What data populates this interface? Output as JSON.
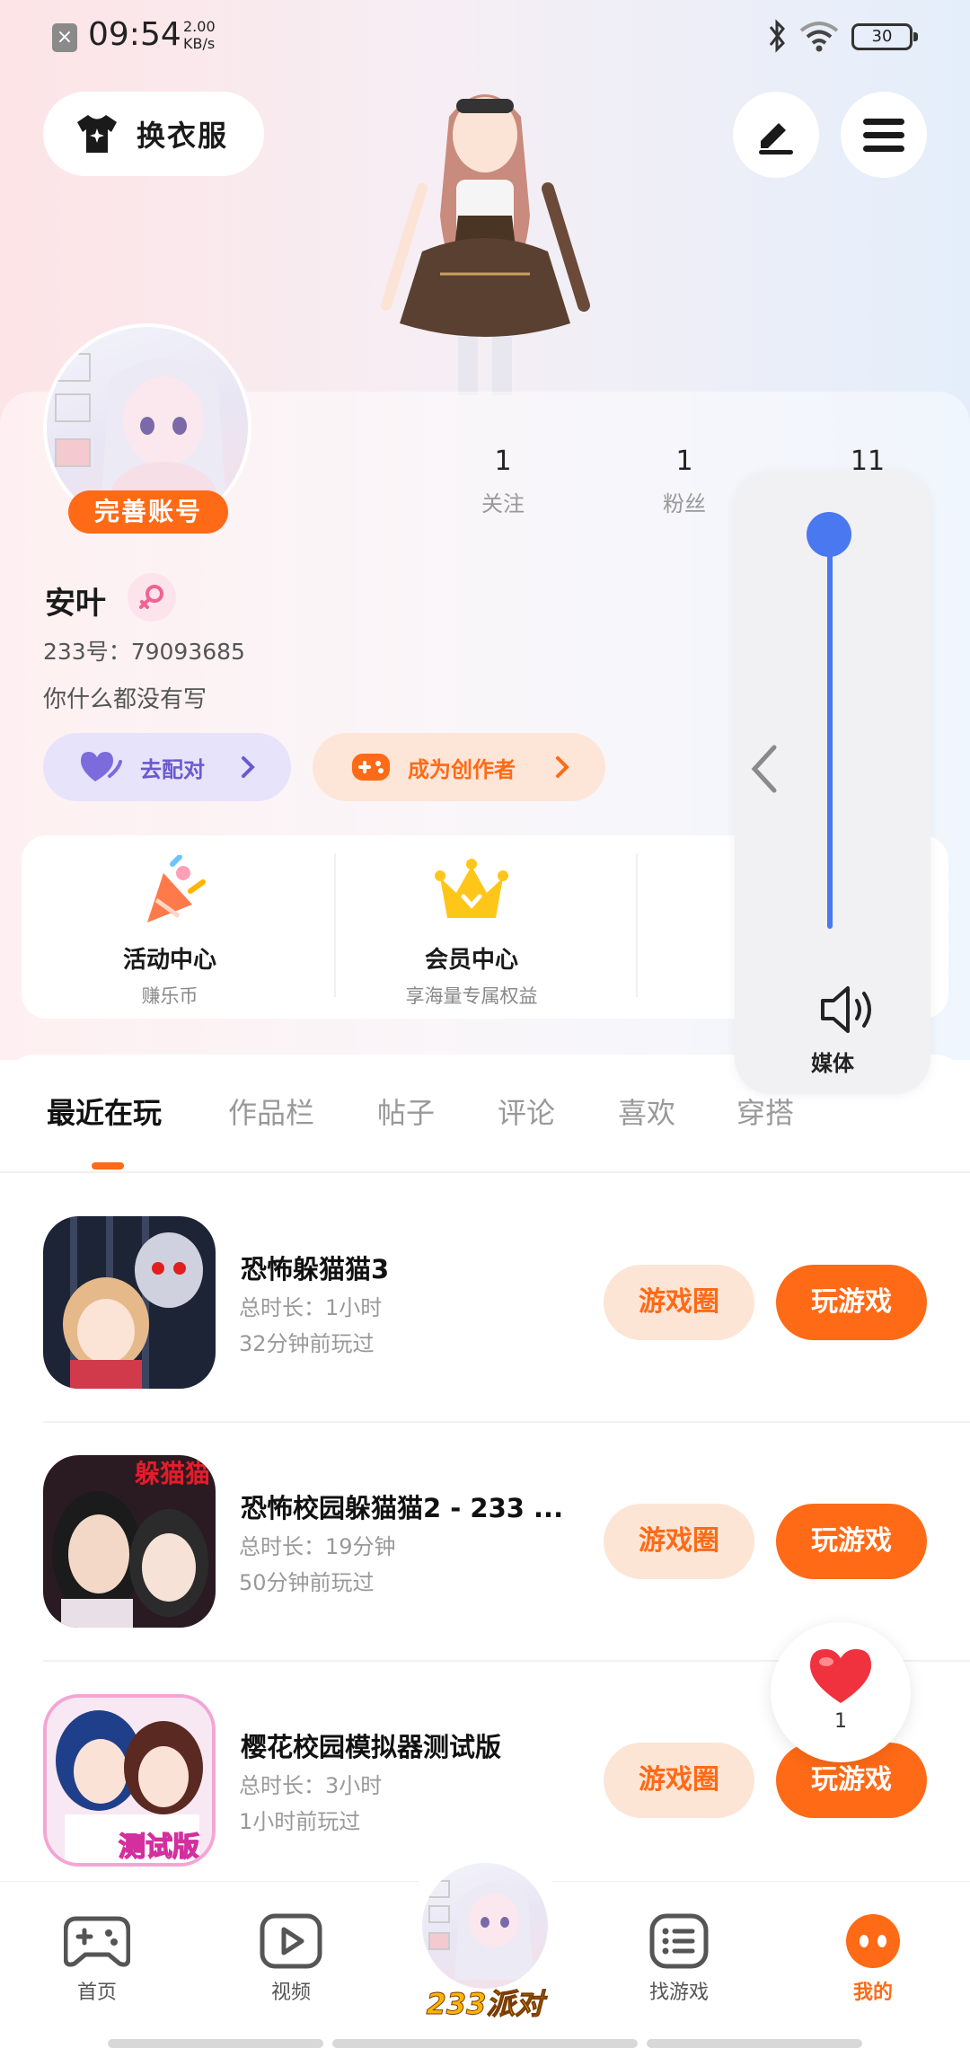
{
  "status_bar": {
    "time": "09:54",
    "speed_value": "2.00",
    "speed_unit": "KB/s",
    "battery": "30"
  },
  "header": {
    "dress_button": "换衣服"
  },
  "profile": {
    "complete_account": "完善账号",
    "stats": [
      {
        "value": "1",
        "label": "关注"
      },
      {
        "value": "1",
        "label": "粉丝"
      },
      {
        "value": "11",
        "label": ""
      }
    ],
    "name": "安叶",
    "uid": "233号：79093685",
    "bio": "你什么都没有写",
    "pair_button": "去配对",
    "creator_button": "成为创作者"
  },
  "features": [
    {
      "title": "活动中心",
      "subtitle": "赚乐币"
    },
    {
      "title": "会员中心",
      "subtitle": "享海量专属权益"
    }
  ],
  "tabs": [
    "最近在玩",
    "作品栏",
    "帖子",
    "评论",
    "喜欢",
    "穿搭"
  ],
  "games": [
    {
      "title": "恐怖躲猫猫3",
      "duration": "总时长：1小时",
      "last_played": "32分钟前玩过",
      "circle_btn": "游戏圈",
      "play_btn": "玩游戏",
      "icon_text": ""
    },
    {
      "title": "恐怖校园躲猫猫2 - 233 ...",
      "duration": "总时长：19分钟",
      "last_played": "50分钟前玩过",
      "circle_btn": "游戏圈",
      "play_btn": "玩游戏",
      "icon_text": "躲猫猫"
    },
    {
      "title": "樱花校园模拟器测试版",
      "duration": "总时长：3小时",
      "last_played": "1小时前玩过",
      "circle_btn": "游戏圈",
      "play_btn": "玩游戏",
      "icon_text": "测试版"
    }
  ],
  "volume": {
    "label": "媒体",
    "level": 1.0
  },
  "like_float": {
    "count": "1"
  },
  "bottom_nav": {
    "items": [
      {
        "label": "首页"
      },
      {
        "label": "视频"
      },
      {
        "label": "233派对"
      },
      {
        "label": "找游戏"
      },
      {
        "label": "我的"
      }
    ]
  },
  "colors": {
    "accent": "#ff6a16",
    "volume": "#4a78f0",
    "pair": "#6a5acd"
  }
}
